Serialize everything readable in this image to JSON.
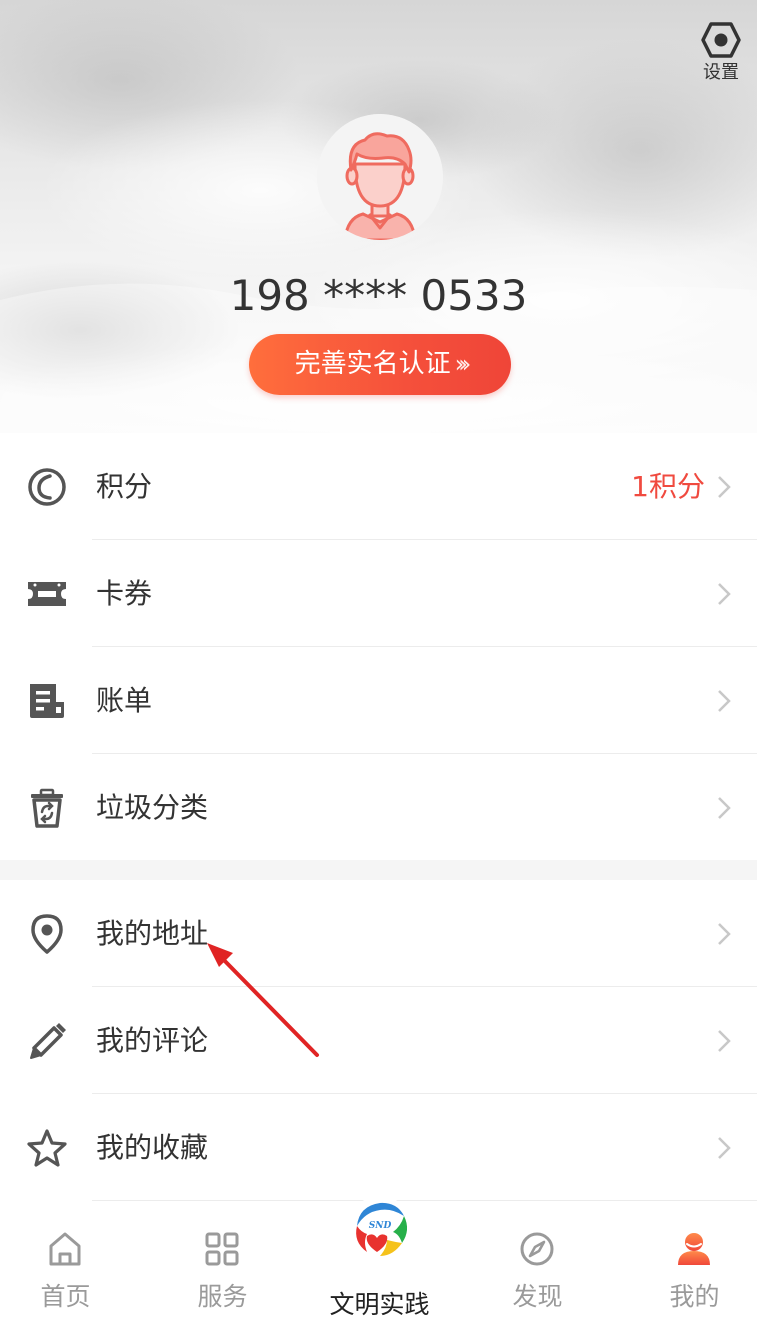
{
  "header": {
    "settings_label": "设置",
    "phone": "198 **** 0533",
    "verify_button": "完善实名认证",
    "verify_chevrons": "›››"
  },
  "menu_group_1": [
    {
      "label": "积分",
      "value": "1积分",
      "icon": "points-icon"
    },
    {
      "label": "卡券",
      "value": "",
      "icon": "ticket-icon"
    },
    {
      "label": "账单",
      "value": "",
      "icon": "bill-icon"
    },
    {
      "label": "垃圾分类",
      "value": "",
      "icon": "recycle-bin-icon"
    }
  ],
  "menu_group_2": [
    {
      "label": "我的地址",
      "value": "",
      "icon": "location-icon"
    },
    {
      "label": "我的评论",
      "value": "",
      "icon": "pencil-icon"
    },
    {
      "label": "我的收藏",
      "value": "",
      "icon": "star-icon"
    }
  ],
  "tabbar": {
    "tabs": [
      {
        "label": "首页",
        "icon": "home-icon"
      },
      {
        "label": "服务",
        "icon": "grid-icon"
      },
      {
        "label": "文明实践",
        "icon": "snd-logo-icon"
      },
      {
        "label": "发现",
        "icon": "compass-icon"
      },
      {
        "label": "我的",
        "icon": "user-icon"
      }
    ],
    "active_index": 4,
    "logo_text": "SND"
  },
  "colors": {
    "accent": "#f04a3f",
    "button_gradient_start": "#ff6e3c",
    "button_gradient_end": "#ef4538",
    "annotation_arrow": "#e02424",
    "icon_gray": "#555555",
    "arrow_gray": "#c8c8c8"
  }
}
